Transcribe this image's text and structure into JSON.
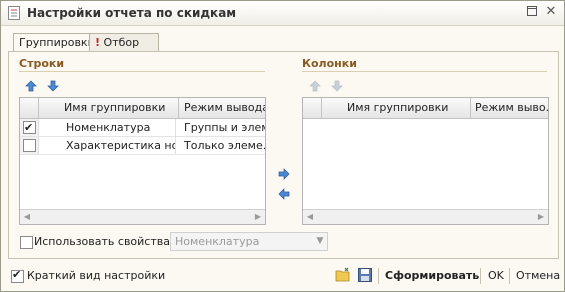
{
  "window": {
    "title": "Настройки отчета по скидкам"
  },
  "tabs": [
    {
      "label": "Группировки",
      "active": true
    },
    {
      "label": "Отбор",
      "active": false,
      "marker": "!"
    }
  ],
  "rows_section": {
    "title": "Строки",
    "columns": [
      "Имя группировки",
      "Режим вывода"
    ],
    "rows": [
      {
        "checked": true,
        "name": "Номенклатура",
        "mode": "Группы и элем"
      },
      {
        "checked": false,
        "name": "Характеристика но...",
        "mode": "Только элеме..."
      }
    ]
  },
  "columns_section": {
    "title": "Колонки",
    "columns": [
      "Имя группировки",
      "Режим выво..."
    ]
  },
  "use_props": {
    "label": "Использовать свойства",
    "checked": false,
    "value": "Номенклатура"
  },
  "footer": {
    "short_view": {
      "label": "Краткий вид настройки",
      "checked": true
    },
    "generate_label": "Сформировать",
    "ok_label": "OK",
    "cancel_label": "Отмена"
  },
  "colors": {
    "section_title": "#8a5a20",
    "arrow_blue": "#4a8ad6",
    "accent_red": "#d02020"
  }
}
